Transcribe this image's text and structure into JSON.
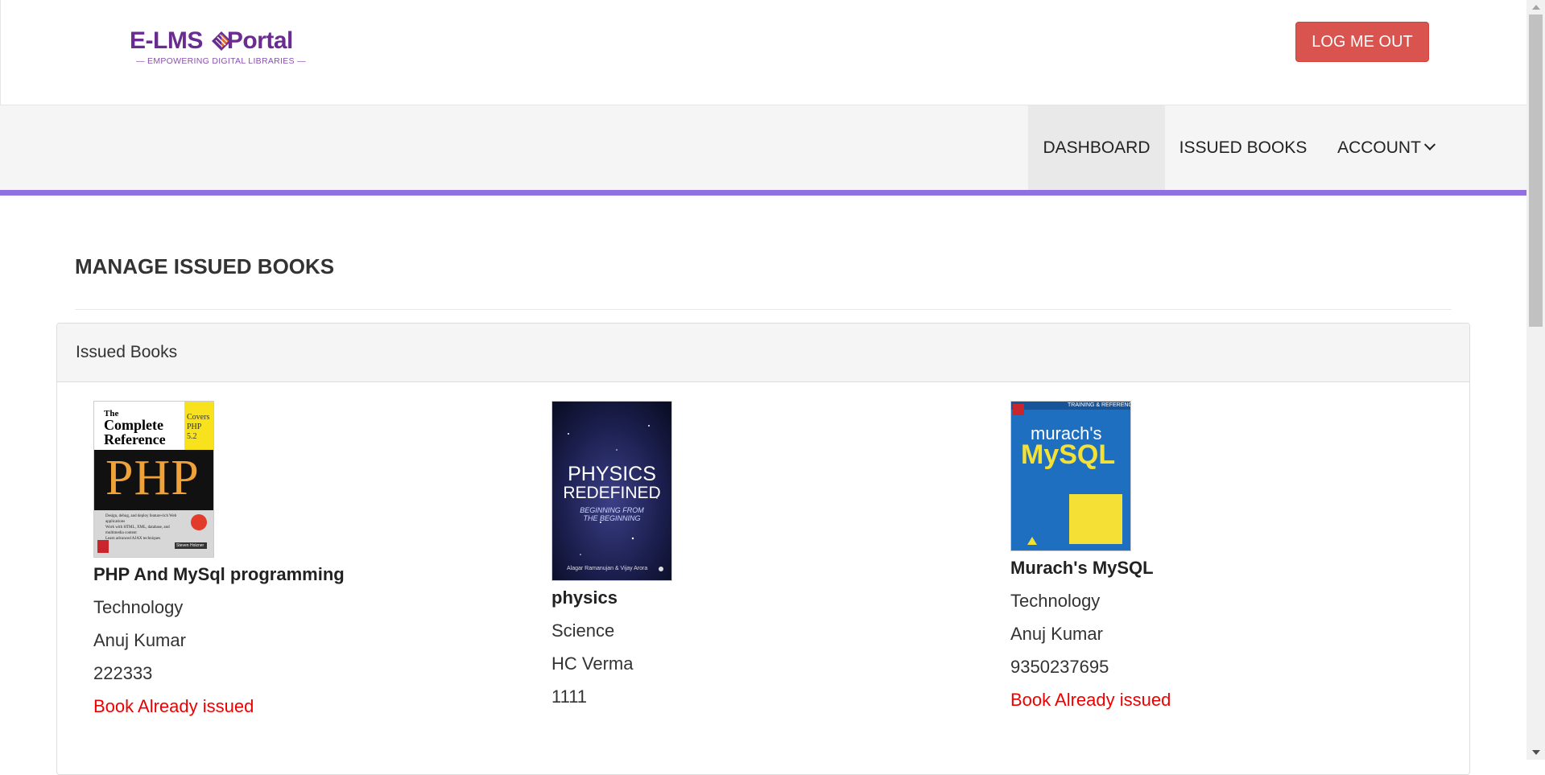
{
  "brand": {
    "name_part1": "E-LMS",
    "name_part2": "Portal",
    "tagline": "— EMPOWERING DIGITAL LIBRARIES —",
    "colors": {
      "primary": "#6b2c91",
      "accent": "#e06a2c"
    }
  },
  "header": {
    "logout_label": "LOG ME OUT"
  },
  "nav": {
    "items": [
      {
        "label": "DASHBOARD",
        "active": true
      },
      {
        "label": "ISSUED BOOKS",
        "active": false
      },
      {
        "label": "ACCOUNT",
        "active": false,
        "icon": "chevron-down-icon"
      }
    ],
    "accent_color": "#9170e1"
  },
  "page": {
    "title": "MANAGE ISSUED BOOKS"
  },
  "panel": {
    "title": "Issued Books"
  },
  "books": [
    {
      "title": "PHP And MySql programming",
      "category": "Technology",
      "author": "Anuj Kumar",
      "isbn": "222333",
      "status": "Book Already issued",
      "cover": {
        "line1": "The",
        "line2": "Complete",
        "line3": "Reference",
        "badge": "Covers PHP 5.2",
        "big": "PHP",
        "bullets": [
          "Design, debug, and deploy feature-rich Web applications",
          "Work with HTML, XML, database, and multimedia content",
          "Learn advanced AJAX techniques"
        ],
        "author": "Steven Holzner"
      }
    },
    {
      "title": "physics",
      "category": "Science",
      "author": "HC Verma",
      "isbn": "1111",
      "status": "",
      "cover": {
        "line1": "PHYSICS",
        "line2": "REDEFINED",
        "sub1": "BEGINNING FROM",
        "sub2": "THE BEGINNING",
        "authors": "Alagar Ramanujan & Vijay Arora"
      }
    },
    {
      "title": "Murach's MySQL",
      "category": "Technology",
      "author": "Anuj Kumar",
      "isbn": "9350237695",
      "status": "Book Already issued",
      "cover": {
        "top": "TRAINING & REFERENCE",
        "brand": "murach's",
        "big": "MySQL"
      }
    }
  ]
}
